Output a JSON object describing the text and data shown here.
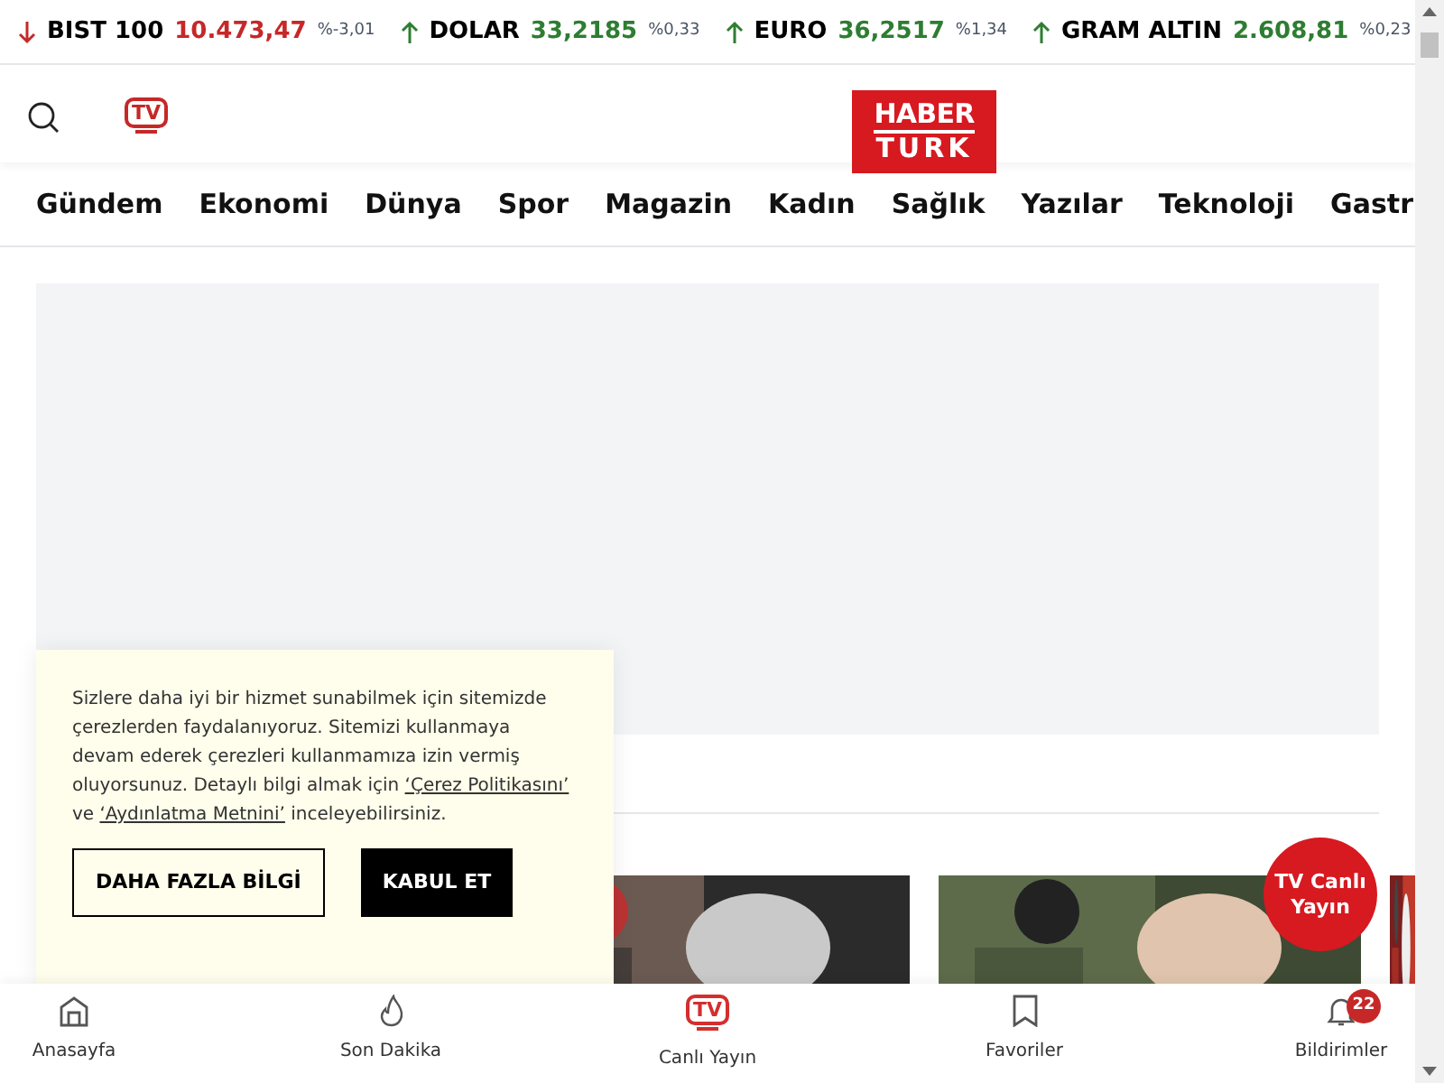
{
  "ticker": [
    {
      "name": "BIST 100",
      "value": "10.473,47",
      "change": "%-3,01",
      "kind": "down"
    },
    {
      "name": "DOLAR",
      "value": "33,2185",
      "change": "%0,33",
      "kind": "up"
    },
    {
      "name": "EURO",
      "value": "36,2517",
      "change": "%1,34",
      "kind": "up"
    },
    {
      "name": "GRAM ALTIN",
      "value": "2.608,81",
      "change": "%0,23",
      "kind": "up"
    }
  ],
  "header": {
    "tv_label": "TV",
    "logo": [
      "HABER",
      "TURK"
    ]
  },
  "nav": [
    "Gündem",
    "Ekonomi",
    "Dünya",
    "Spor",
    "Magazin",
    "Kadın",
    "Sağlık",
    "Yazılar",
    "Teknoloji",
    "Gastr"
  ],
  "cookie": {
    "segments": [
      {
        "kind": "text",
        "text": "Sizlere daha iyi bir hizmet sunabilmek için sitemizde çerezlerden faydalanıyoruz. Sitemizi kullanmaya devam ederek çerezleri kullanmamıza izin vermiş oluyorsunuz. Detaylı bilgi almak için "
      },
      {
        "kind": "link",
        "text": "‘Çerez Politikasını’"
      },
      {
        "kind": "text",
        "text": " ve "
      },
      {
        "kind": "link",
        "text": "‘Aydınlatma Metnini’"
      },
      {
        "kind": "text",
        "text": " inceleyebilirsiniz."
      }
    ],
    "buttons": [
      {
        "label": "DAHA FAZLA BİLGİ",
        "kind": "outline"
      },
      {
        "label": "KABUL ET",
        "kind": "solid"
      }
    ]
  },
  "live_badge": "TV Canlı Yayın",
  "bottom_nav": [
    {
      "label": "Anasayfa",
      "kind": "home",
      "selected": false
    },
    {
      "label": "Son Dakika",
      "kind": "fire",
      "selected": false
    },
    {
      "label": "Canlı Yayın",
      "kind": "tv",
      "icon_text": "TV",
      "selected": true
    },
    {
      "label": "Favoriler",
      "kind": "bookmark",
      "selected": false
    },
    {
      "label": "Bildirimler",
      "kind": "bell",
      "badge": "22",
      "selected": false
    }
  ]
}
